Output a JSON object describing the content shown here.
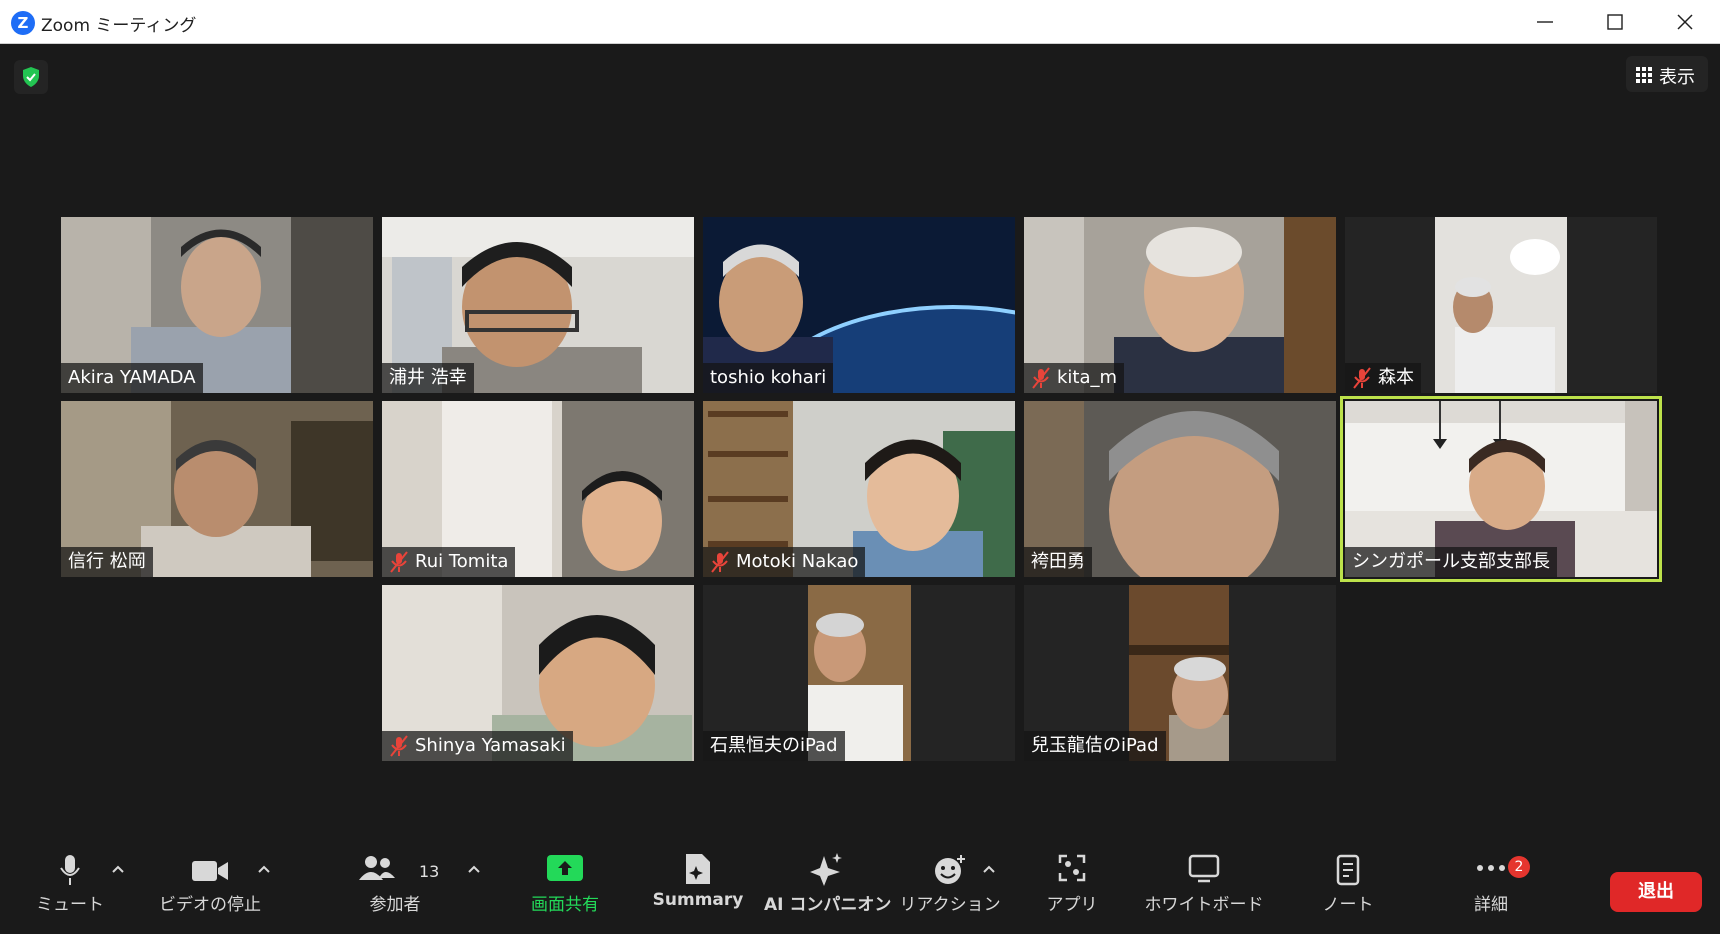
{
  "window": {
    "title": "Zoom ミーティング"
  },
  "header": {
    "view_label": "表示"
  },
  "participants": [
    {
      "name": "Akira YAMADA",
      "muted": false
    },
    {
      "name": "浦井 浩幸",
      "muted": false
    },
    {
      "name": "toshio kohari",
      "muted": false
    },
    {
      "name": "kita_m",
      "muted": true
    },
    {
      "name": "森本",
      "muted": true
    },
    {
      "name": "信行 松岡",
      "muted": false
    },
    {
      "name": "Rui Tomita",
      "muted": true
    },
    {
      "name": "Motoki Nakao",
      "muted": true
    },
    {
      "name": "袴田勇",
      "muted": false
    },
    {
      "name": "シンガポール支部支部長",
      "muted": false,
      "active_speaker": true
    },
    {
      "name": "Shinya Yamasaki",
      "muted": true
    },
    {
      "name": "石黒恒夫のiPad",
      "muted": false
    },
    {
      "name": "兒玉龍佶のiPad",
      "muted": false
    }
  ],
  "toolbar": {
    "mute": "ミュート",
    "video": "ビデオの停止",
    "participants": "参加者",
    "participants_count": "13",
    "share": "画面共有",
    "summary": "Summary",
    "ai": "AI コンパニオン",
    "reactions": "リアクション",
    "apps": "アプリ",
    "whiteboard": "ホワイトボード",
    "notes": "ノート",
    "more": "詳細",
    "more_badge": "2",
    "leave": "退出"
  },
  "colors": {
    "background": "#1a1a1a",
    "active_speaker_border": "#bde24b",
    "share_green": "#23d959",
    "leave_red": "#e02828",
    "zoom_blue": "#1e6df6"
  }
}
